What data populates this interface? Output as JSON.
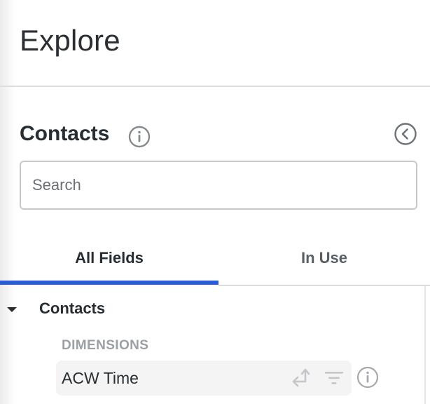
{
  "header": {
    "title": "Explore"
  },
  "explore": {
    "title": "Contacts",
    "info_icon": "info-icon",
    "collapse_icon": "chevron-left-circle-icon"
  },
  "search": {
    "placeholder": "Search",
    "value": ""
  },
  "tabs": [
    {
      "label": "All Fields",
      "active": true
    },
    {
      "label": "In Use",
      "active": false
    }
  ],
  "field_tree": {
    "groups": [
      {
        "label": "Contacts",
        "expanded": true,
        "sections": [
          {
            "heading": "DIMENSIONS",
            "fields": [
              {
                "label": "ACW Time",
                "actions": [
                  "pivot-icon",
                  "filter-icon",
                  "info-icon"
                ]
              }
            ]
          }
        ]
      }
    ]
  },
  "colors": {
    "accent": "#2b5bd7",
    "muted_text": "#9aa0a6",
    "text": "#262d33",
    "icon": "#868b90"
  }
}
